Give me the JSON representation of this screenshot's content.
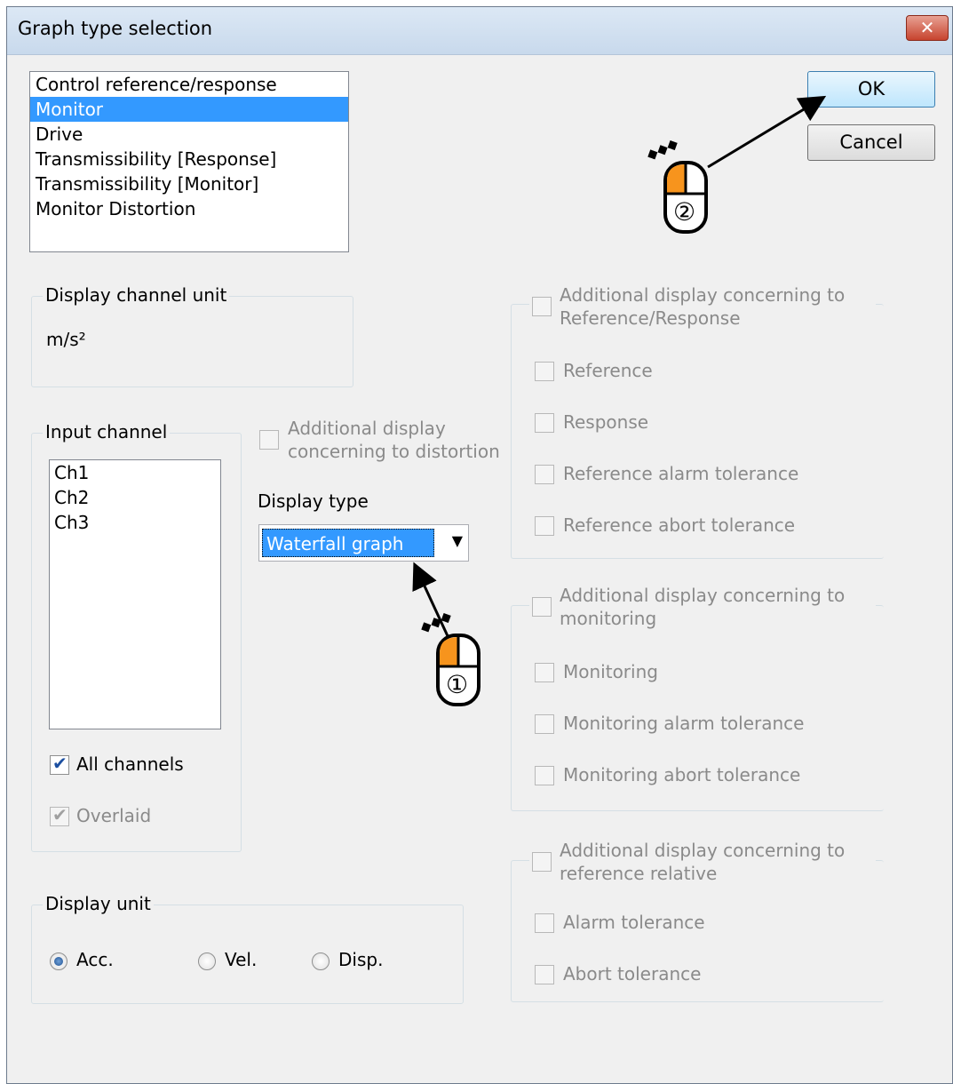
{
  "window": {
    "title": "Graph type selection",
    "close_glyph": "✕"
  },
  "graph_list": {
    "items": [
      {
        "label": "Control reference/response",
        "selected": false
      },
      {
        "label": "Monitor",
        "selected": true
      },
      {
        "label": "Drive",
        "selected": false
      },
      {
        "label": "Transmissibility [Response]",
        "selected": false
      },
      {
        "label": "Transmissibility [Monitor]",
        "selected": false
      },
      {
        "label": "Monitor Distortion",
        "selected": false
      }
    ]
  },
  "buttons": {
    "ok": "OK",
    "cancel": "Cancel"
  },
  "display_channel_unit": {
    "label": "Display channel unit",
    "value": "m/s²"
  },
  "input_channel": {
    "label": "Input channel",
    "channels": [
      "Ch1",
      "Ch2",
      "Ch3"
    ],
    "all_channels": {
      "label": "All channels",
      "checked": true
    },
    "overlaid": {
      "label": "Overlaid",
      "checked": true,
      "disabled": true
    }
  },
  "distortion": {
    "line1": "Additional display",
    "line2": "concerning to distortion",
    "checked": false
  },
  "display_type": {
    "label": "Display type",
    "value": "Waterfall graph"
  },
  "display_unit": {
    "label": "Display unit",
    "options": [
      {
        "label": "Acc.",
        "selected": true
      },
      {
        "label": "Vel.",
        "selected": false
      },
      {
        "label": "Disp.",
        "selected": false
      }
    ]
  },
  "ref_response_group": {
    "line1": "Additional display concerning to",
    "line2": "Reference/Response",
    "items": [
      "Reference",
      "Response",
      "Reference alarm tolerance",
      "Reference abort tolerance"
    ]
  },
  "monitoring_group": {
    "line1": "Additional display concerning to",
    "line2": "monitoring",
    "items": [
      "Monitoring",
      "Monitoring alarm tolerance",
      "Monitoring abort tolerance"
    ]
  },
  "ref_relative_group": {
    "line1": "Additional display concerning to",
    "line2": "reference relative",
    "items": [
      "Alarm tolerance",
      "Abort tolerance"
    ]
  },
  "annotations": {
    "step1": "①",
    "step2": "②",
    "accent": "#f7941d"
  }
}
